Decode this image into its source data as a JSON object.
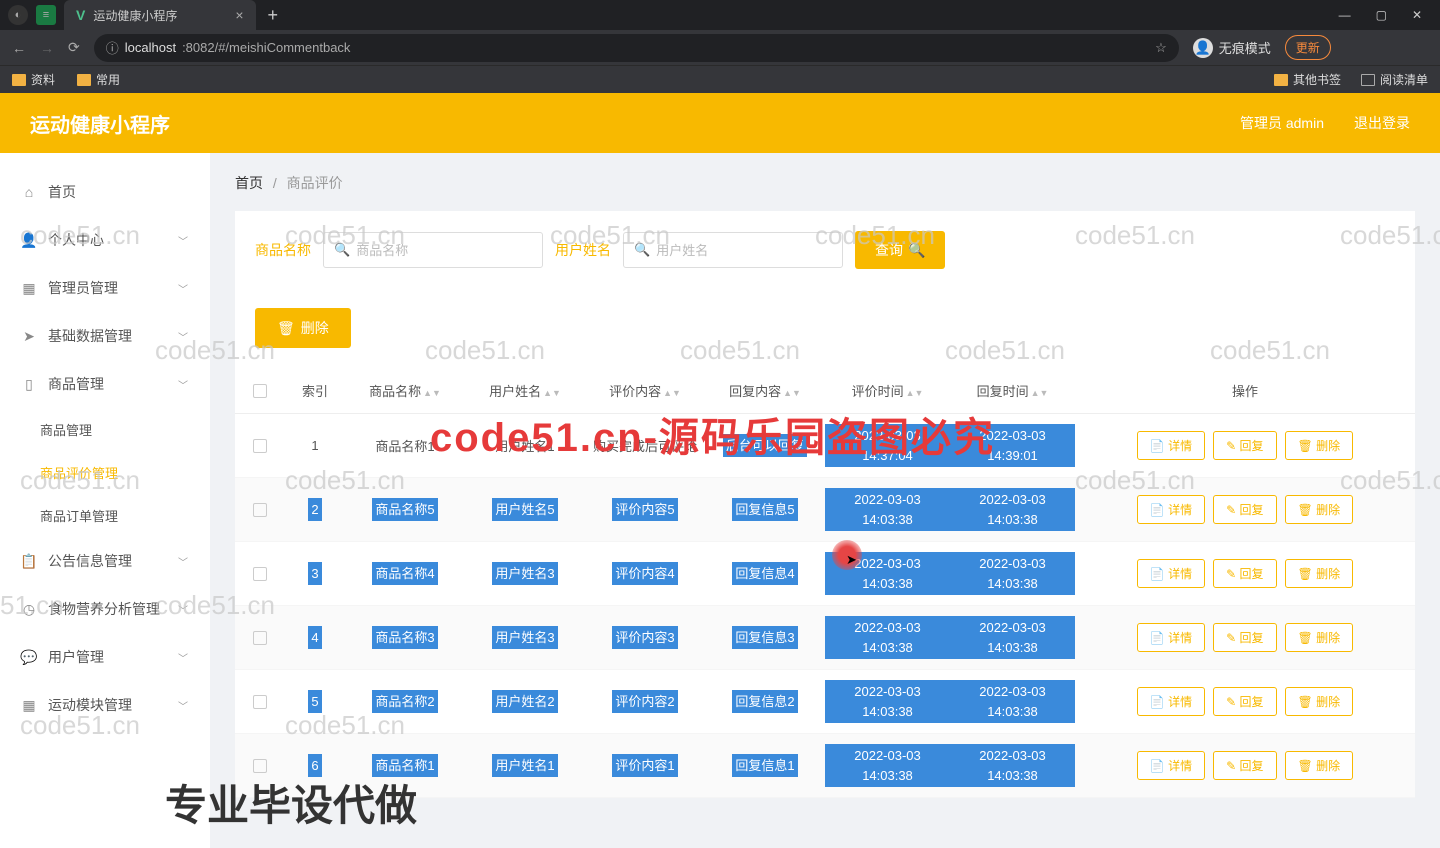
{
  "browser": {
    "tab_title": "运动健康小程序",
    "url_host": "localhost",
    "url_port": ":8082/#/meishiCommentback",
    "incognito": "无痕模式",
    "update_btn": "更新",
    "bookmarks": {
      "b1": "资料",
      "b2": "常用",
      "other": "其他书签",
      "readlist": "阅读清单"
    }
  },
  "header": {
    "title": "运动健康小程序",
    "admin": "管理员 admin",
    "logout": "退出登录"
  },
  "sidebar": {
    "home": "首页",
    "personal": "个人中心",
    "admin": "管理员管理",
    "basedata": "基础数据管理",
    "product": "商品管理",
    "sub_product": "商品管理",
    "sub_review": "商品评价管理",
    "sub_order": "商品订单管理",
    "notice": "公告信息管理",
    "nutrition": "食物营养分析管理",
    "user": "用户管理",
    "sport": "运动模块管理"
  },
  "breadcrumb": {
    "home": "首页",
    "current": "商品评价"
  },
  "filter": {
    "product_label": "商品名称",
    "product_ph": "商品名称",
    "user_label": "用户姓名",
    "user_ph": "用户姓名",
    "query": "查询",
    "delete": "删除"
  },
  "table": {
    "headers": {
      "idx": "索引",
      "pname": "商品名称",
      "uname": "用户姓名",
      "review": "评价内容",
      "reply": "回复内容",
      "rtime": "评价时间",
      "rptime": "回复时间",
      "ops": "操作"
    },
    "ops": {
      "detail": "详情",
      "reply": "回复",
      "delete": "删除"
    },
    "rows": [
      {
        "idx": "1",
        "pname": "商品名称1",
        "uname": "用户姓名1",
        "review": "购买完成后可评论",
        "reply": "后台可以回复",
        "rtime": "2022-03-03 14:37:04",
        "rptime": "2022-03-03 14:39:01",
        "hl": false,
        "reply_hl": true,
        "time_hl": true
      },
      {
        "idx": "2",
        "pname": "商品名称5",
        "uname": "用户姓名5",
        "review": "评价内容5",
        "reply": "回复信息5",
        "rtime": "2022-03-03 14:03:38",
        "rptime": "2022-03-03 14:03:38",
        "hl": true
      },
      {
        "idx": "3",
        "pname": "商品名称4",
        "uname": "用户姓名3",
        "review": "评价内容4",
        "reply": "回复信息4",
        "rtime": "2022-03-03 14:03:38",
        "rptime": "2022-03-03 14:03:38",
        "hl": true
      },
      {
        "idx": "4",
        "pname": "商品名称3",
        "uname": "用户姓名3",
        "review": "评价内容3",
        "reply": "回复信息3",
        "rtime": "2022-03-03 14:03:38",
        "rptime": "2022-03-03 14:03:38",
        "hl": true
      },
      {
        "idx": "5",
        "pname": "商品名称2",
        "uname": "用户姓名2",
        "review": "评价内容2",
        "reply": "回复信息2",
        "rtime": "2022-03-03 14:03:38",
        "rptime": "2022-03-03 14:03:38",
        "hl": true
      },
      {
        "idx": "6",
        "pname": "商品名称1",
        "uname": "用户姓名1",
        "review": "评价内容1",
        "reply": "回复信息1",
        "rtime": "2022-03-03 14:03:38",
        "rptime": "2022-03-03 14:03:38",
        "hl": true
      }
    ]
  },
  "watermark": {
    "text": "code51.cn",
    "red": "code51.cn-源码乐园盗图必究",
    "bottom": "专业毕设代做"
  }
}
